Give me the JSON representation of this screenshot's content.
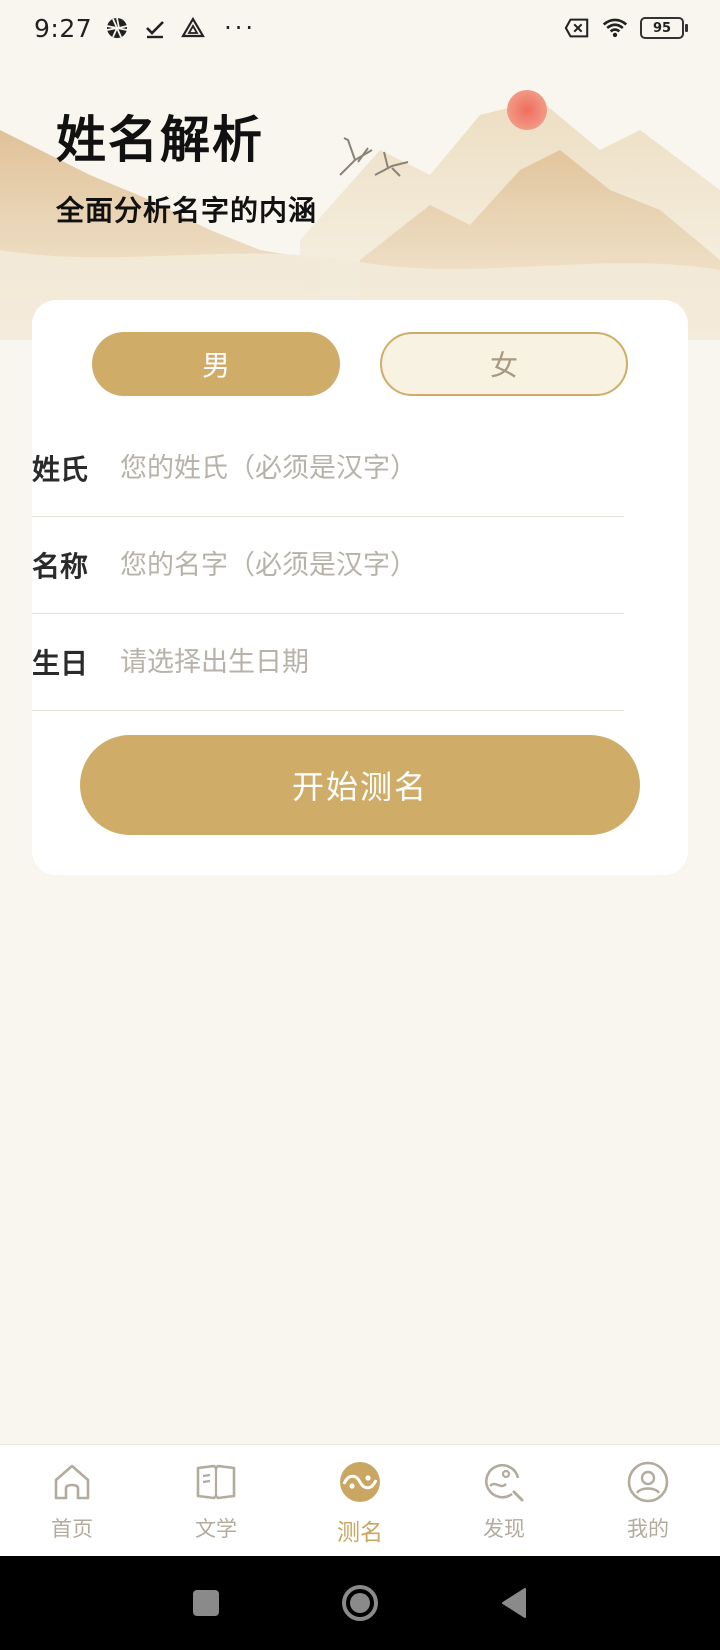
{
  "status_bar": {
    "time": "9:27",
    "dots": "···",
    "battery": "95"
  },
  "header": {
    "title": "姓名解析",
    "subtitle": "全面分析名字的内涵"
  },
  "gender": {
    "male": "男",
    "female": "女",
    "selected": "male"
  },
  "form": {
    "surname": {
      "label": "姓氏",
      "placeholder": "您的姓氏（必须是汉字）",
      "value": ""
    },
    "given_name": {
      "label": "名称",
      "placeholder": "您的名字（必须是汉字）",
      "value": ""
    },
    "birthday": {
      "label": "生日",
      "placeholder": "请选择出生日期",
      "value": ""
    },
    "submit_label": "开始测名"
  },
  "bottom_nav": {
    "items": [
      {
        "label": "首页",
        "icon": "home-icon"
      },
      {
        "label": "文学",
        "icon": "book-icon"
      },
      {
        "label": "测名",
        "icon": "yin-yang-icon",
        "active": true
      },
      {
        "label": "发现",
        "icon": "discover-icon"
      },
      {
        "label": "我的",
        "icon": "profile-icon"
      }
    ]
  },
  "colors": {
    "accent": "#cfad68",
    "background": "#f8f6ee",
    "inactive": "#b3ab9e"
  }
}
